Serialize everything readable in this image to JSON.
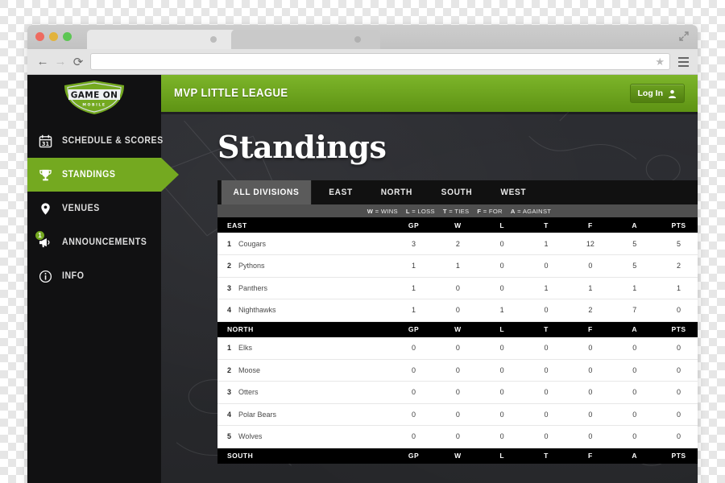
{
  "browser": {
    "tabs": [
      {
        "name": "tab-active",
        "title": ""
      },
      {
        "name": "tab-inactive",
        "title": ""
      }
    ],
    "back_icon": "←",
    "forward_icon": "→",
    "reload_icon": "⟳",
    "url_value": "",
    "url_placeholder": "",
    "star_icon": "★",
    "menu_icon": "hamburger-icon",
    "expand_icon": "expand-arrows-icon"
  },
  "sidebar": {
    "logo": {
      "line1": "GAME ON",
      "line2": "MOBILE"
    },
    "items": [
      {
        "label": "Schedule & Scores",
        "icon": "calendar-icon",
        "icon_text": "31",
        "active": false,
        "badge": ""
      },
      {
        "label": "Standings",
        "icon": "trophy-icon",
        "active": true,
        "badge": ""
      },
      {
        "label": "Venues",
        "icon": "map-pin-icon",
        "active": false,
        "badge": ""
      },
      {
        "label": "Announcements",
        "icon": "megaphone-icon",
        "active": false,
        "badge": "1"
      },
      {
        "label": "Info",
        "icon": "info-circle-icon",
        "active": false,
        "badge": ""
      }
    ]
  },
  "header": {
    "league_name": "MVP Little League",
    "login_label": "Log In",
    "login_icon": "user-icon"
  },
  "main": {
    "page_title": "Standings",
    "tabs": [
      {
        "label": "All Divisions",
        "active": true
      },
      {
        "label": "East",
        "active": false
      },
      {
        "label": "North",
        "active": false
      },
      {
        "label": "South",
        "active": false
      },
      {
        "label": "West",
        "active": false
      }
    ],
    "legend": [
      {
        "key": "W",
        "eq": "=",
        "value": "Wins"
      },
      {
        "key": "L",
        "eq": "=",
        "value": "Loss"
      },
      {
        "key": "T",
        "eq": "=",
        "value": "Ties"
      },
      {
        "key": "F",
        "eq": "=",
        "value": "For"
      },
      {
        "key": "A",
        "eq": "=",
        "value": "Against"
      }
    ],
    "columns": [
      "GP",
      "W",
      "L",
      "T",
      "F",
      "A",
      "PTS"
    ],
    "divisions": [
      {
        "name": "East",
        "rows": [
          {
            "rank": "1",
            "team": "Cougars",
            "stats": [
              "3",
              "2",
              "0",
              "1",
              "12",
              "5",
              "5"
            ]
          },
          {
            "rank": "2",
            "team": "Pythons",
            "stats": [
              "1",
              "1",
              "0",
              "0",
              "0",
              "5",
              "2"
            ]
          },
          {
            "rank": "3",
            "team": "Panthers",
            "stats": [
              "1",
              "0",
              "0",
              "1",
              "1",
              "1",
              "1"
            ]
          },
          {
            "rank": "4",
            "team": "Nighthawks",
            "stats": [
              "1",
              "0",
              "1",
              "0",
              "2",
              "7",
              "0"
            ]
          }
        ]
      },
      {
        "name": "North",
        "rows": [
          {
            "rank": "1",
            "team": "Elks",
            "stats": [
              "0",
              "0",
              "0",
              "0",
              "0",
              "0",
              "0"
            ]
          },
          {
            "rank": "2",
            "team": "Moose",
            "stats": [
              "0",
              "0",
              "0",
              "0",
              "0",
              "0",
              "0"
            ]
          },
          {
            "rank": "3",
            "team": "Otters",
            "stats": [
              "0",
              "0",
              "0",
              "0",
              "0",
              "0",
              "0"
            ]
          },
          {
            "rank": "4",
            "team": "Polar Bears",
            "stats": [
              "0",
              "0",
              "0",
              "0",
              "0",
              "0",
              "0"
            ]
          },
          {
            "rank": "5",
            "team": "Wolves",
            "stats": [
              "0",
              "0",
              "0",
              "0",
              "0",
              "0",
              "0"
            ]
          }
        ]
      },
      {
        "name": "South",
        "rows": []
      }
    ]
  },
  "colors": {
    "brand_green": "#74a920",
    "header_green_top": "#7db52a",
    "header_green_bottom": "#5e9314",
    "sidebar_black": "#111112",
    "board_dark": "#2b2c31",
    "tab_active_gray": "#5b5b5b",
    "legend_gray": "#4f4f4f"
  }
}
